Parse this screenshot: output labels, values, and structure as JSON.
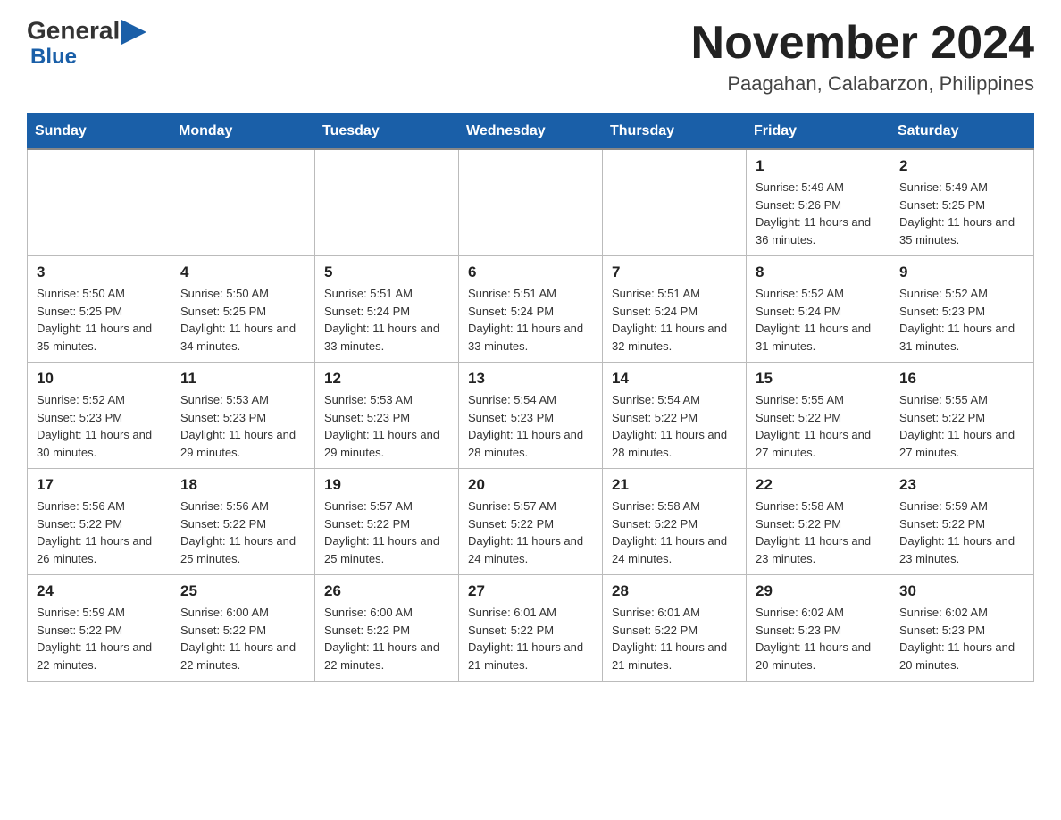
{
  "logo": {
    "general": "General",
    "blue": "Blue",
    "arrow": "▶"
  },
  "title": "November 2024",
  "subtitle": "Paagahan, Calabarzon, Philippines",
  "days_of_week": [
    "Sunday",
    "Monday",
    "Tuesday",
    "Wednesday",
    "Thursday",
    "Friday",
    "Saturday"
  ],
  "weeks": [
    [
      {
        "day": "",
        "info": ""
      },
      {
        "day": "",
        "info": ""
      },
      {
        "day": "",
        "info": ""
      },
      {
        "day": "",
        "info": ""
      },
      {
        "day": "",
        "info": ""
      },
      {
        "day": "1",
        "info": "Sunrise: 5:49 AM\nSunset: 5:26 PM\nDaylight: 11 hours and 36 minutes."
      },
      {
        "day": "2",
        "info": "Sunrise: 5:49 AM\nSunset: 5:25 PM\nDaylight: 11 hours and 35 minutes."
      }
    ],
    [
      {
        "day": "3",
        "info": "Sunrise: 5:50 AM\nSunset: 5:25 PM\nDaylight: 11 hours and 35 minutes."
      },
      {
        "day": "4",
        "info": "Sunrise: 5:50 AM\nSunset: 5:25 PM\nDaylight: 11 hours and 34 minutes."
      },
      {
        "day": "5",
        "info": "Sunrise: 5:51 AM\nSunset: 5:24 PM\nDaylight: 11 hours and 33 minutes."
      },
      {
        "day": "6",
        "info": "Sunrise: 5:51 AM\nSunset: 5:24 PM\nDaylight: 11 hours and 33 minutes."
      },
      {
        "day": "7",
        "info": "Sunrise: 5:51 AM\nSunset: 5:24 PM\nDaylight: 11 hours and 32 minutes."
      },
      {
        "day": "8",
        "info": "Sunrise: 5:52 AM\nSunset: 5:24 PM\nDaylight: 11 hours and 31 minutes."
      },
      {
        "day": "9",
        "info": "Sunrise: 5:52 AM\nSunset: 5:23 PM\nDaylight: 11 hours and 31 minutes."
      }
    ],
    [
      {
        "day": "10",
        "info": "Sunrise: 5:52 AM\nSunset: 5:23 PM\nDaylight: 11 hours and 30 minutes."
      },
      {
        "day": "11",
        "info": "Sunrise: 5:53 AM\nSunset: 5:23 PM\nDaylight: 11 hours and 29 minutes."
      },
      {
        "day": "12",
        "info": "Sunrise: 5:53 AM\nSunset: 5:23 PM\nDaylight: 11 hours and 29 minutes."
      },
      {
        "day": "13",
        "info": "Sunrise: 5:54 AM\nSunset: 5:23 PM\nDaylight: 11 hours and 28 minutes."
      },
      {
        "day": "14",
        "info": "Sunrise: 5:54 AM\nSunset: 5:22 PM\nDaylight: 11 hours and 28 minutes."
      },
      {
        "day": "15",
        "info": "Sunrise: 5:55 AM\nSunset: 5:22 PM\nDaylight: 11 hours and 27 minutes."
      },
      {
        "day": "16",
        "info": "Sunrise: 5:55 AM\nSunset: 5:22 PM\nDaylight: 11 hours and 27 minutes."
      }
    ],
    [
      {
        "day": "17",
        "info": "Sunrise: 5:56 AM\nSunset: 5:22 PM\nDaylight: 11 hours and 26 minutes."
      },
      {
        "day": "18",
        "info": "Sunrise: 5:56 AM\nSunset: 5:22 PM\nDaylight: 11 hours and 25 minutes."
      },
      {
        "day": "19",
        "info": "Sunrise: 5:57 AM\nSunset: 5:22 PM\nDaylight: 11 hours and 25 minutes."
      },
      {
        "day": "20",
        "info": "Sunrise: 5:57 AM\nSunset: 5:22 PM\nDaylight: 11 hours and 24 minutes."
      },
      {
        "day": "21",
        "info": "Sunrise: 5:58 AM\nSunset: 5:22 PM\nDaylight: 11 hours and 24 minutes."
      },
      {
        "day": "22",
        "info": "Sunrise: 5:58 AM\nSunset: 5:22 PM\nDaylight: 11 hours and 23 minutes."
      },
      {
        "day": "23",
        "info": "Sunrise: 5:59 AM\nSunset: 5:22 PM\nDaylight: 11 hours and 23 minutes."
      }
    ],
    [
      {
        "day": "24",
        "info": "Sunrise: 5:59 AM\nSunset: 5:22 PM\nDaylight: 11 hours and 22 minutes."
      },
      {
        "day": "25",
        "info": "Sunrise: 6:00 AM\nSunset: 5:22 PM\nDaylight: 11 hours and 22 minutes."
      },
      {
        "day": "26",
        "info": "Sunrise: 6:00 AM\nSunset: 5:22 PM\nDaylight: 11 hours and 22 minutes."
      },
      {
        "day": "27",
        "info": "Sunrise: 6:01 AM\nSunset: 5:22 PM\nDaylight: 11 hours and 21 minutes."
      },
      {
        "day": "28",
        "info": "Sunrise: 6:01 AM\nSunset: 5:22 PM\nDaylight: 11 hours and 21 minutes."
      },
      {
        "day": "29",
        "info": "Sunrise: 6:02 AM\nSunset: 5:23 PM\nDaylight: 11 hours and 20 minutes."
      },
      {
        "day": "30",
        "info": "Sunrise: 6:02 AM\nSunset: 5:23 PM\nDaylight: 11 hours and 20 minutes."
      }
    ]
  ]
}
